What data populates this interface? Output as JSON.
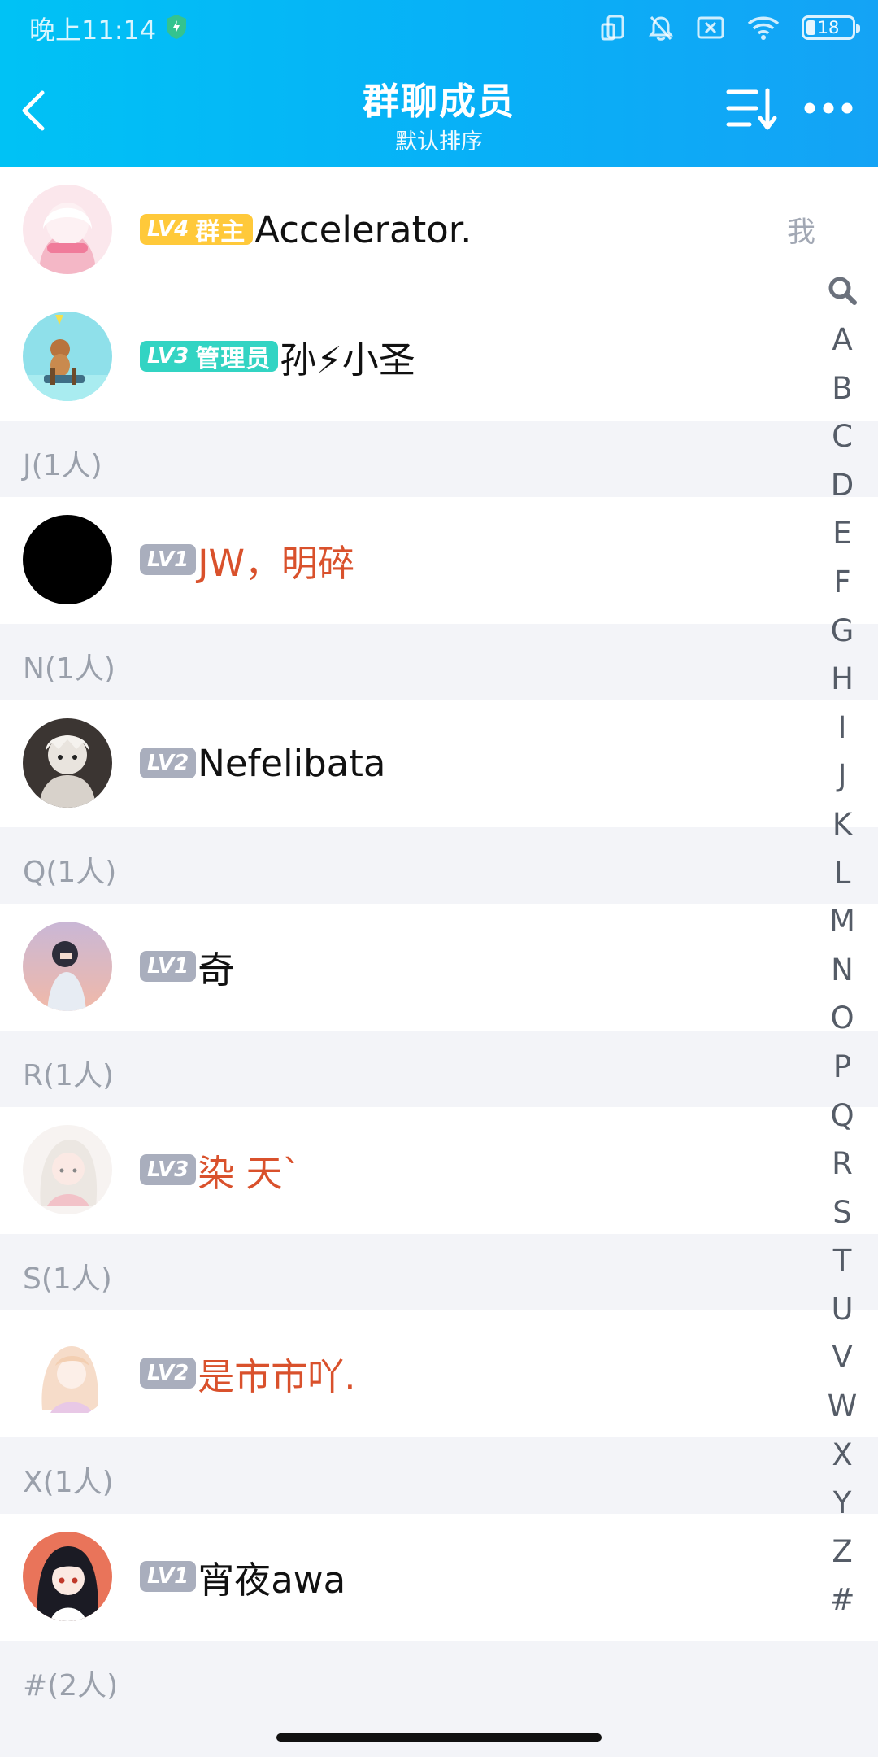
{
  "status_bar": {
    "time": "晚上11:14",
    "battery": "18",
    "battery_level": 0.18
  },
  "header": {
    "title": "群聊成员",
    "subtitle": "默认排序"
  },
  "top_members": [
    {
      "badge": "LV4",
      "role": "群主",
      "name": "Accelerator.",
      "suffix": "我"
    },
    {
      "badge": "LV3",
      "role": "管理员",
      "name": "孙⚡小圣"
    }
  ],
  "sections": [
    {
      "header": "J(1人)",
      "members": [
        {
          "badge": "LV1",
          "name": "JW，明碎"
        }
      ]
    },
    {
      "header": "N(1人)",
      "members": [
        {
          "badge": "LV2",
          "name": "Nefelibata"
        }
      ]
    },
    {
      "header": "Q(1人)",
      "members": [
        {
          "badge": "LV1",
          "name": "奇"
        }
      ]
    },
    {
      "header": "R(1人)",
      "members": [
        {
          "badge": "LV3",
          "name": "染 天`"
        }
      ]
    },
    {
      "header": "S(1人)",
      "members": [
        {
          "badge": "LV2",
          "name": "是市市吖."
        }
      ]
    },
    {
      "header": "X(1人)",
      "members": [
        {
          "badge": "LV1",
          "name": "宵夜awa"
        }
      ]
    },
    {
      "header": "#(2人)",
      "members": []
    }
  ],
  "index_letters": [
    "A",
    "B",
    "C",
    "D",
    "E",
    "F",
    "G",
    "H",
    "I",
    "J",
    "K",
    "L",
    "M",
    "N",
    "O",
    "P",
    "Q",
    "R",
    "S",
    "T",
    "U",
    "V",
    "W",
    "X",
    "Y",
    "Z",
    "#"
  ],
  "colors": {
    "header_start": "#00c2f5",
    "header_end": "#14a3f5",
    "red_name": "#d9512c",
    "owner_badge": "#ffc93a",
    "admin_badge": "#33d4c3",
    "level_badge": "#a9aebd"
  }
}
